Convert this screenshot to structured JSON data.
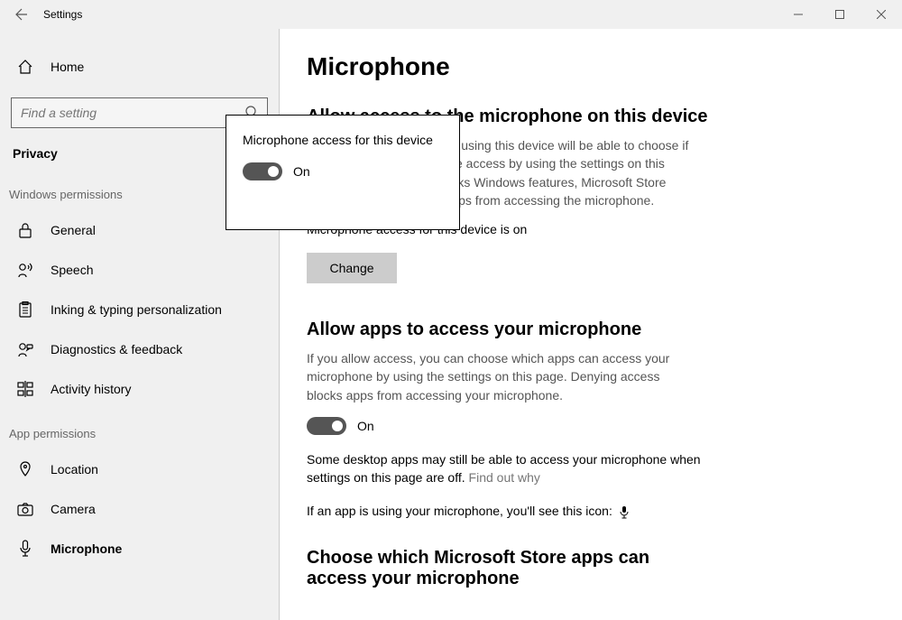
{
  "window": {
    "title": "Settings"
  },
  "sidebar": {
    "home": "Home",
    "search_placeholder": "Find a setting",
    "breadcrumb": "Privacy",
    "group1_label": "Windows permissions",
    "group1": [
      {
        "label": "General"
      },
      {
        "label": "Speech"
      },
      {
        "label": "Inking & typing personalization"
      },
      {
        "label": "Diagnostics & feedback"
      },
      {
        "label": "Activity history"
      }
    ],
    "group2_label": "App permissions",
    "group2": [
      {
        "label": "Location"
      },
      {
        "label": "Camera"
      },
      {
        "label": "Microphone"
      }
    ]
  },
  "popup": {
    "title": "Microphone access for this device",
    "toggle_label": "On"
  },
  "content": {
    "page_title": "Microphone",
    "section1": {
      "heading": "Allow access to the microphone on this device",
      "desc": "If you allow access, people using this device will be able to choose if their apps have microphone access by using the settings on this page. Denying access blocks Windows features, Microsoft Store apps, and most desktop apps from accessing the microphone.",
      "status": "Microphone access for this device is on",
      "change_btn": "Change"
    },
    "section2": {
      "heading": "Allow apps to access your microphone",
      "desc": "If you allow access, you can choose which apps can access your microphone by using the settings on this page. Denying access blocks apps from accessing your microphone.",
      "toggle_label": "On",
      "note_prefix": "Some desktop apps may still be able to access your microphone when settings on this page are off. ",
      "note_link": "Find out why",
      "icon_note": "If an app is using your microphone, you'll see this icon:"
    },
    "section3": {
      "heading": "Choose which Microsoft Store apps can access your microphone"
    }
  }
}
